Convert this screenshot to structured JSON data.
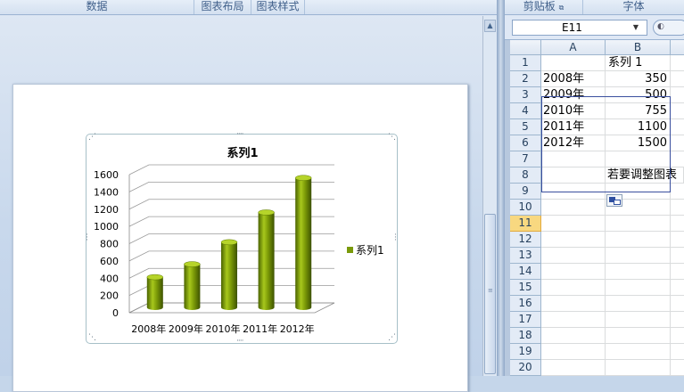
{
  "ribbon_left": {
    "groups": [
      "数据",
      "图表布局",
      "图表样式"
    ]
  },
  "ribbon_right": {
    "groups": [
      "剪贴板",
      "字体"
    ]
  },
  "name_box": {
    "value": "E11"
  },
  "sheet": {
    "columns": [
      "A",
      "B"
    ],
    "rows": [
      {
        "n": "1",
        "a": "",
        "b": "系列 1"
      },
      {
        "n": "2",
        "a": "2008年",
        "b": "350"
      },
      {
        "n": "3",
        "a": "2009年",
        "b": "500"
      },
      {
        "n": "4",
        "a": "2010年",
        "b": "755"
      },
      {
        "n": "5",
        "a": "2011年",
        "b": "1100"
      },
      {
        "n": "6",
        "a": "2012年",
        "b": "1500"
      },
      {
        "n": "7",
        "a": "",
        "b": ""
      },
      {
        "n": "8",
        "a": "",
        "b": "若要调整图表"
      },
      {
        "n": "9",
        "a": "",
        "b": ""
      },
      {
        "n": "10",
        "a": "",
        "b": ""
      },
      {
        "n": "11",
        "a": "",
        "b": ""
      },
      {
        "n": "12",
        "a": "",
        "b": ""
      },
      {
        "n": "13",
        "a": "",
        "b": ""
      },
      {
        "n": "14",
        "a": "",
        "b": ""
      },
      {
        "n": "15",
        "a": "",
        "b": ""
      },
      {
        "n": "16",
        "a": "",
        "b": ""
      },
      {
        "n": "17",
        "a": "",
        "b": ""
      },
      {
        "n": "18",
        "a": "",
        "b": ""
      },
      {
        "n": "19",
        "a": "",
        "b": ""
      },
      {
        "n": "20",
        "a": "",
        "b": ""
      }
    ],
    "selected_row": "11"
  },
  "chart_data": {
    "type": "bar",
    "title": "系列1",
    "categories": [
      "2008年",
      "2009年",
      "2010年",
      "2011年",
      "2012年"
    ],
    "series": [
      {
        "name": "系列1",
        "values": [
          350,
          500,
          755,
          1100,
          1500
        ]
      }
    ],
    "ylim": [
      0,
      1600
    ],
    "yticks": [
      "0",
      "200",
      "400",
      "600",
      "800",
      "1000",
      "1200",
      "1400",
      "1600"
    ],
    "grid": true,
    "legend": "right",
    "bar_color": "#7a9a0a"
  }
}
